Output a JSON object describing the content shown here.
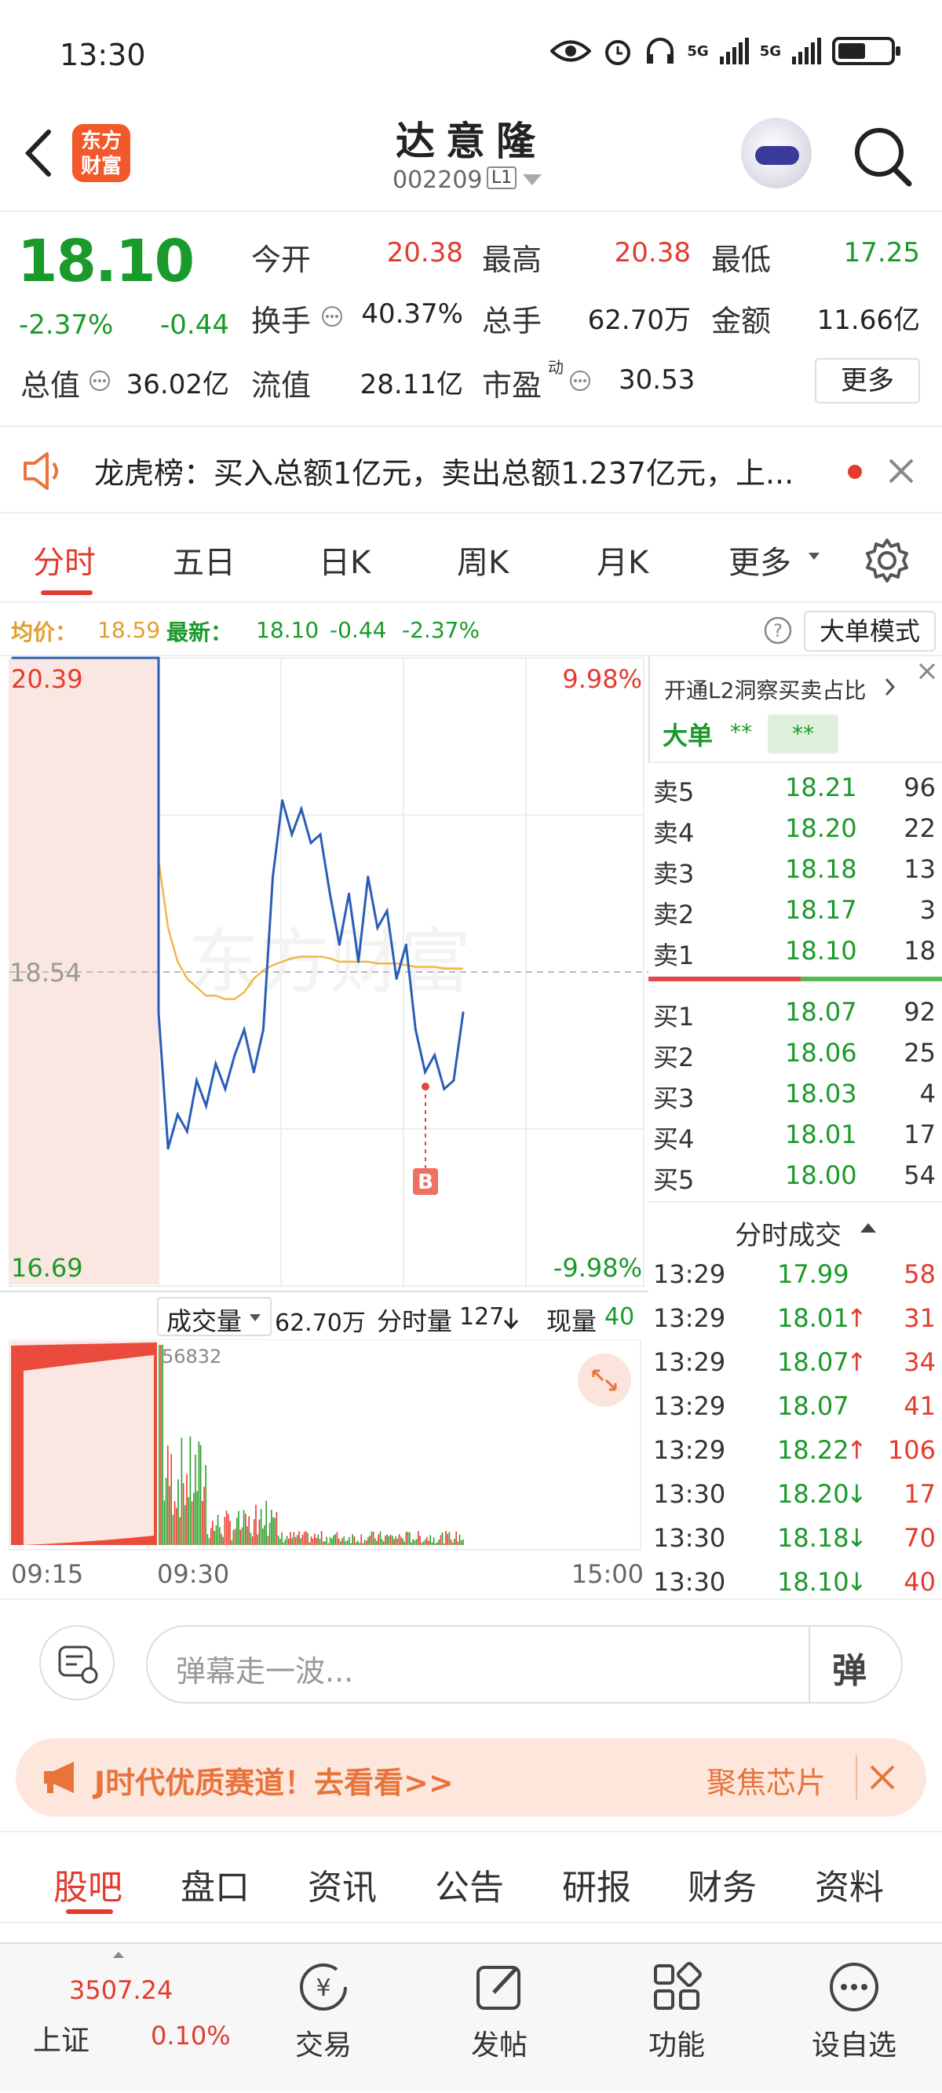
{
  "status": {
    "time": "13:30",
    "network1": "5G",
    "network2": "5G"
  },
  "header": {
    "stock_name": "达意隆",
    "stock_code": "002209",
    "level": "L1",
    "logo_text": "东方财富"
  },
  "quote": {
    "price": "18.10",
    "change_pct": "-2.37%",
    "change": "-0.44",
    "open_label": "今开",
    "open": "20.38",
    "high_label": "最高",
    "high": "20.38",
    "low_label": "最低",
    "low": "17.25",
    "turnover_label": "换手",
    "turnover": "40.37%",
    "volume_label": "总手",
    "volume": "62.70万",
    "amount_label": "金额",
    "amount": "11.66亿",
    "mktcap_label": "总值",
    "mktcap": "36.02亿",
    "float_label": "流值",
    "float_cap": "28.11亿",
    "pe_label": "市盈",
    "pe_sup": "动",
    "pe": "30.53",
    "more_button": "更多"
  },
  "notice": {
    "text": "龙虎榜：买入总额1亿元，卖出总额1.237亿元，上..."
  },
  "tabs": [
    "分时",
    "五日",
    "日K",
    "周K",
    "月K",
    "更多"
  ],
  "infobar": {
    "avg_label": "均价：",
    "avg": "18.59",
    "latest_label": "最新：",
    "latest": "18.10",
    "latest_chg": "-0.44",
    "latest_pct": "-2.37%",
    "mode_button": "大单模式"
  },
  "chart": {
    "y_top": "20.39",
    "y_mid": "18.54",
    "y_bot": "16.69",
    "pct_top": "9.98%",
    "pct_bot": "-9.98%",
    "marker": "B",
    "watermark": "东方财富",
    "vol_label": "成交量",
    "vol_total": "62.70万",
    "tick_vol_label": "分时量",
    "tick_vol": "127",
    "cur_vol_label": "现量",
    "cur_vol": "40",
    "vol_max": "56832",
    "x_start": "09:15",
    "x_open": "09:30",
    "x_end": "15:00"
  },
  "chart_data": {
    "type": "line",
    "title": "",
    "ylim": [
      16.69,
      20.39
    ],
    "reference": 18.54,
    "x_range": [
      "09:15",
      "15:00"
    ],
    "series": [
      {
        "values": [
          20.39,
          18.3,
          17.5,
          17.7,
          17.6,
          17.9,
          17.75,
          18.0,
          17.85,
          18.05,
          18.2,
          17.95,
          18.2,
          19.1,
          19.55,
          19.35,
          19.5,
          19.3,
          19.35,
          19.0,
          18.7,
          19.0,
          18.6,
          19.1,
          18.8,
          18.9,
          18.5,
          18.7,
          18.2,
          17.95,
          18.05,
          17.85,
          17.9,
          18.3
        ]
      },
      {
        "values": [
          20.39,
          19.2,
          18.8,
          18.6,
          18.5,
          18.45,
          18.4,
          18.4,
          18.38,
          18.38,
          18.42,
          18.5,
          18.55,
          18.58,
          18.6,
          18.62,
          18.63,
          18.63,
          18.63,
          18.62,
          18.6,
          18.6,
          18.6,
          18.6,
          18.59,
          18.59,
          18.59,
          18.58,
          18.57,
          18.57,
          18.57,
          18.56,
          18.56,
          18.56
        ]
      }
    ]
  },
  "orderbook": {
    "promo": "开通L2洞察买卖占比",
    "big_label": "大单",
    "big_val1": "**",
    "big_val2": "**",
    "asks": [
      {
        "label": "卖5",
        "price": "18.21",
        "vol": "96"
      },
      {
        "label": "卖4",
        "price": "18.20",
        "vol": "22"
      },
      {
        "label": "卖3",
        "price": "18.18",
        "vol": "13"
      },
      {
        "label": "卖2",
        "price": "18.17",
        "vol": "3"
      },
      {
        "label": "卖1",
        "price": "18.10",
        "vol": "18"
      }
    ],
    "bids": [
      {
        "label": "买1",
        "price": "18.07",
        "vol": "92"
      },
      {
        "label": "买2",
        "price": "18.06",
        "vol": "25"
      },
      {
        "label": "买3",
        "price": "18.03",
        "vol": "4"
      },
      {
        "label": "买4",
        "price": "18.01",
        "vol": "17"
      },
      {
        "label": "买5",
        "price": "18.00",
        "vol": "54"
      }
    ],
    "ticks_title": "分时成交",
    "ticks": [
      {
        "time": "13:29",
        "price": "17.99",
        "dir": "",
        "vol": "58"
      },
      {
        "time": "13:29",
        "price": "18.01",
        "dir": "↑",
        "vol": "31"
      },
      {
        "time": "13:29",
        "price": "18.07",
        "dir": "↑",
        "vol": "34"
      },
      {
        "time": "13:29",
        "price": "18.07",
        "dir": "",
        "vol": "41"
      },
      {
        "time": "13:29",
        "price": "18.22",
        "dir": "↑",
        "vol": "106"
      },
      {
        "time": "13:30",
        "price": "18.20",
        "dir": "↓",
        "vol": "17"
      },
      {
        "time": "13:30",
        "price": "18.18",
        "dir": "↓",
        "vol": "70"
      },
      {
        "time": "13:30",
        "price": "18.10",
        "dir": "↓",
        "vol": "40"
      }
    ]
  },
  "controls": {
    "danmu_placeholder": "弹幕走一波...",
    "danmu_button": "弹"
  },
  "banner": {
    "text": "J时代优质赛道！去看看>>",
    "right": "聚焦芯片"
  },
  "subtabs": [
    "股吧",
    "盘口",
    "资讯",
    "公告",
    "研报",
    "财务",
    "资料"
  ],
  "bottombar": {
    "index_value": "3507.24",
    "index_name": "上证",
    "index_pct": "0.10%",
    "trade": "交易",
    "post": "发帖",
    "func": "功能",
    "watch": "设自选"
  }
}
